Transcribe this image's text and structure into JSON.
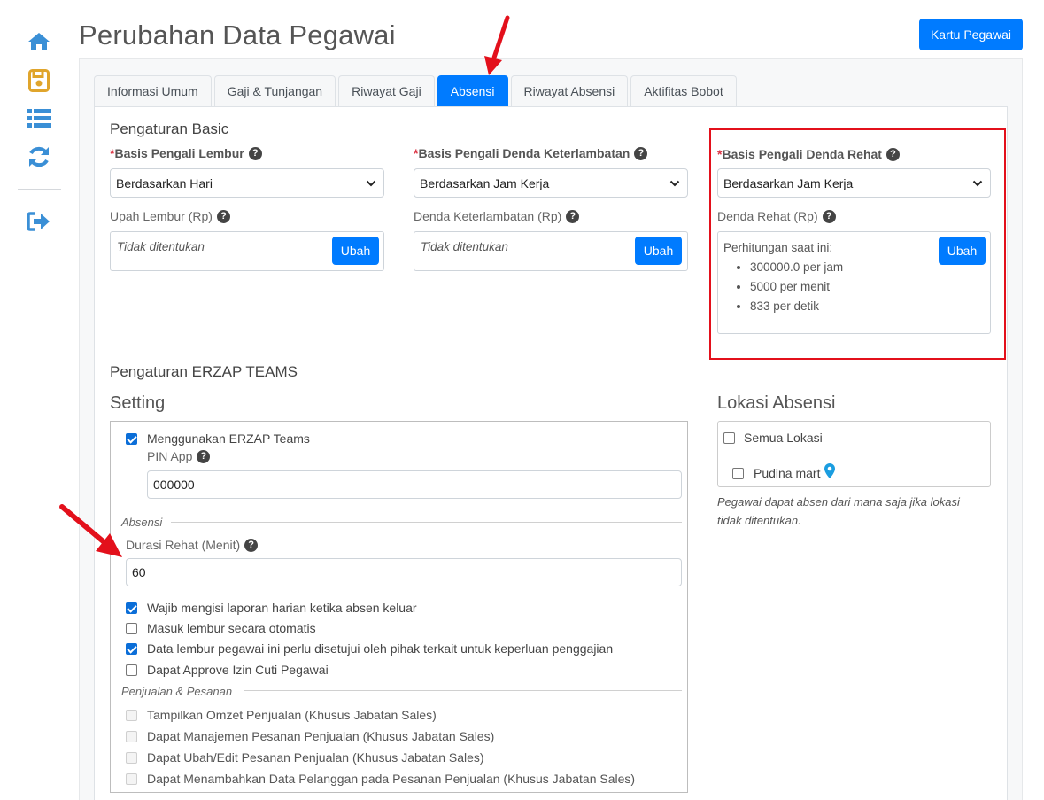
{
  "sidebar": {
    "icons": [
      "home-icon",
      "save-icon",
      "list-icon",
      "refresh-icon",
      "logout-icon"
    ],
    "colors": {
      "home": "#3a8fd6",
      "save": "#e0a52c",
      "list": "#3a8fd6",
      "refresh": "#3a8fd6",
      "logout": "#3a8fd6"
    }
  },
  "header": {
    "title": "Perubahan Data Pegawai",
    "kartu_button": "Kartu Pegawai"
  },
  "tabs": [
    {
      "label": "Informasi Umum",
      "active": false
    },
    {
      "label": "Gaji & Tunjangan",
      "active": false
    },
    {
      "label": "Riwayat Gaji",
      "active": false
    },
    {
      "label": "Absensi",
      "active": true
    },
    {
      "label": "Riwayat Absensi",
      "active": false
    },
    {
      "label": "Aktifitas Bobot",
      "active": false
    }
  ],
  "basic": {
    "heading": "Pengaturan Basic",
    "required_mark": "*",
    "lembur": {
      "label": "Basis Pengali Lembur",
      "value": "Berdasarkan Hari",
      "upah_label": "Upah Lembur (Rp)",
      "upah_value": "Tidak ditentukan",
      "button": "Ubah"
    },
    "keterlambatan": {
      "label": "Basis Pengali Denda Keterlambatan",
      "value": "Berdasarkan Jam Kerja",
      "denda_label": "Denda Keterlambatan (Rp)",
      "denda_value": "Tidak ditentukan",
      "button": "Ubah"
    },
    "rehat": {
      "label": "Basis Pengali Denda Rehat",
      "value": "Berdasarkan Jam Kerja",
      "denda_label": "Denda Rehat (Rp)",
      "calc_title": "Perhitungan saat ini:",
      "calc_items": [
        "300000.0 per jam",
        "5000 per menit",
        "833 per detik"
      ],
      "button": "Ubah"
    }
  },
  "teams": {
    "heading": "Pengaturan ERZAP TEAMS",
    "setting_title": "Setting",
    "use_teams": {
      "label": "Menggunakan ERZAP Teams",
      "checked": true
    },
    "pin_label": "PIN App",
    "pin_value": "000000",
    "absensi_legend": "Absensi",
    "durasi_label": "Durasi Rehat (Menit)",
    "durasi_value": "60",
    "options": [
      {
        "label": "Wajib mengisi laporan harian ketika absen keluar",
        "checked": true
      },
      {
        "label": "Masuk lembur secara otomatis",
        "checked": false
      },
      {
        "label": "Data lembur pegawai ini perlu disetujui oleh pihak terkait untuk keperluan penggajian",
        "checked": true
      },
      {
        "label": "Dapat Approve Izin Cuti Pegawai",
        "checked": false
      }
    ],
    "penjualan_legend": "Penjualan & Pesanan",
    "penjualan_options": [
      {
        "label": "Tampilkan Omzet Penjualan (Khusus Jabatan Sales)",
        "disabled": true
      },
      {
        "label": "Dapat Manajemen Pesanan Penjualan (Khusus Jabatan Sales)",
        "disabled": true
      },
      {
        "label": "Dapat Ubah/Edit Pesanan Penjualan (Khusus Jabatan Sales)",
        "disabled": true
      },
      {
        "label": "Dapat Menambahkan Data Pelanggan pada Pesanan Penjualan (Khusus Jabatan Sales)",
        "disabled": true
      }
    ]
  },
  "lokasi": {
    "title": "Lokasi Absensi",
    "all_label": "Semua Lokasi",
    "location_label": "Pudina mart",
    "note": "Pegawai dapat absen dari mana saja jika lokasi tidak ditentukan."
  },
  "colors": {
    "primary": "#007bff",
    "highlight": "#e3101b",
    "required": "#dc3545"
  }
}
